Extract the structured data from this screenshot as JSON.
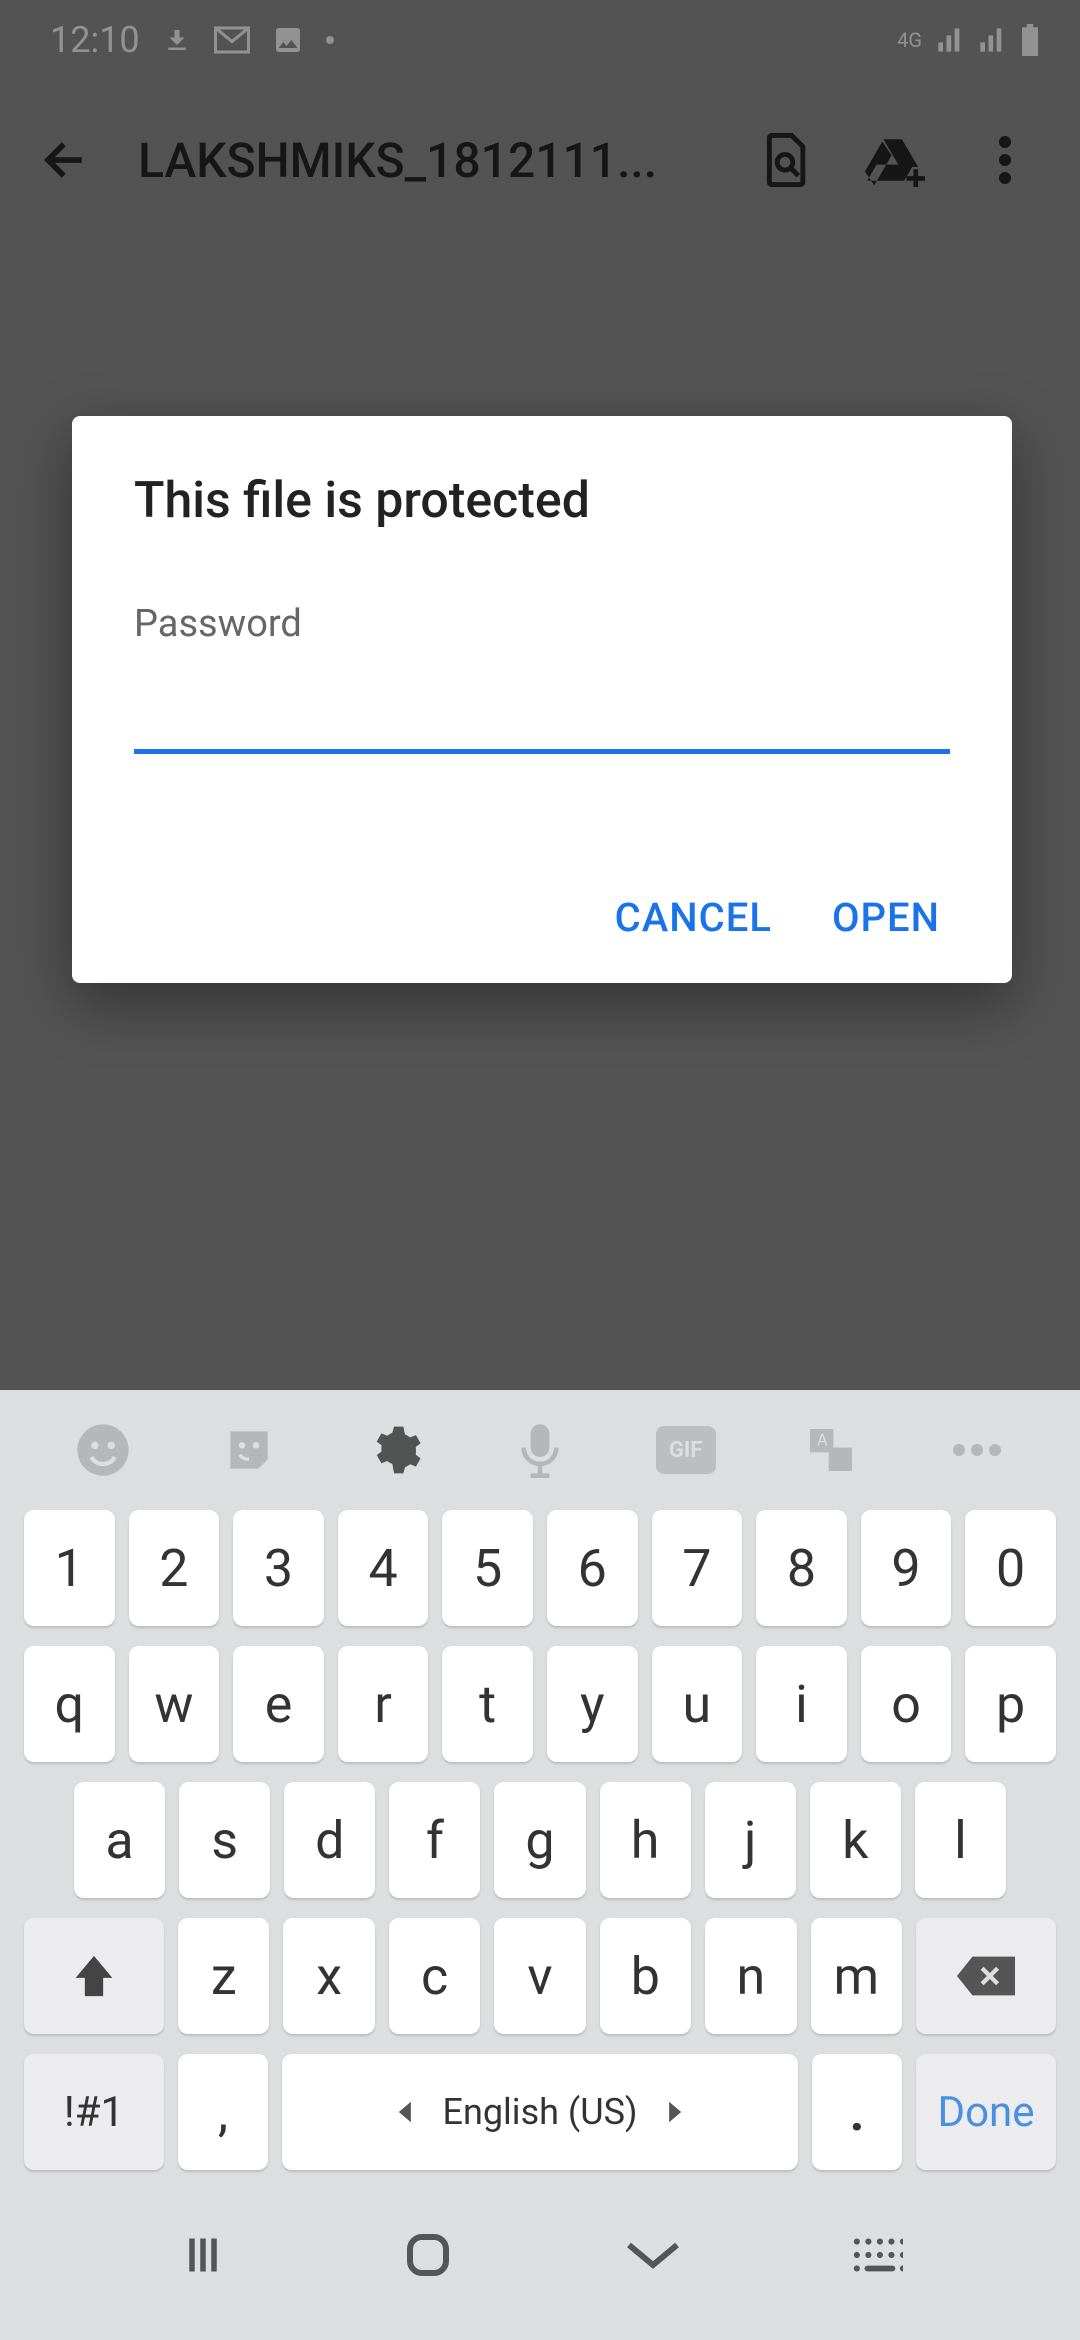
{
  "status": {
    "time": "12:10",
    "network_type": "4G"
  },
  "header": {
    "title": "LAKSHMIKS_1812111..."
  },
  "dialog": {
    "title": "This file is protected",
    "password_label": "Password",
    "password_value": "",
    "cancel_label": "CANCEL",
    "open_label": "OPEN"
  },
  "keyboard": {
    "row_numbers": [
      "1",
      "2",
      "3",
      "4",
      "5",
      "6",
      "7",
      "8",
      "9",
      "0"
    ],
    "row_top": [
      "q",
      "w",
      "e",
      "r",
      "t",
      "y",
      "u",
      "i",
      "o",
      "p"
    ],
    "row_mid": [
      "a",
      "s",
      "d",
      "f",
      "g",
      "h",
      "j",
      "k",
      "l"
    ],
    "row_bot": [
      "z",
      "x",
      "c",
      "v",
      "b",
      "n",
      "m"
    ],
    "symbol_key": "!#1",
    "comma_key": ",",
    "space_label": "English (US)",
    "period_key": ".",
    "done_label": "Done"
  }
}
